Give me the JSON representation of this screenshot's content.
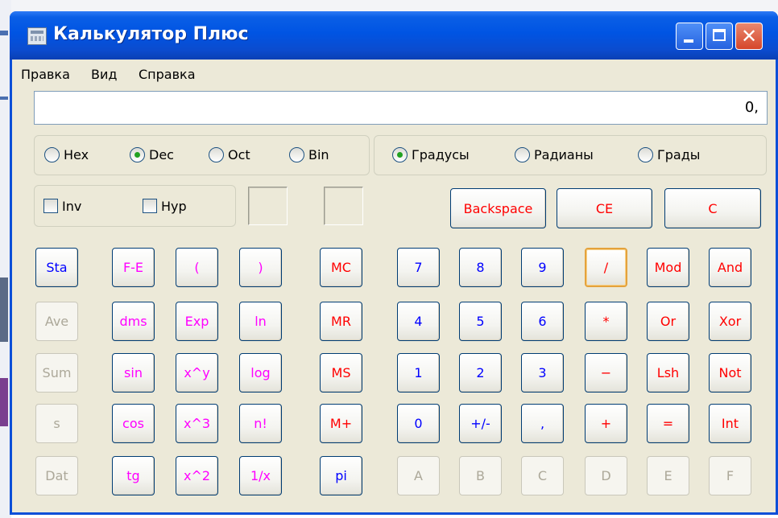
{
  "window": {
    "title": "Калькулятор Плюс"
  },
  "menu": [
    "Правка",
    "Вид",
    "Справка"
  ],
  "display": {
    "value": "0,"
  },
  "number_base": {
    "options": [
      "Hex",
      "Dec",
      "Oct",
      "Bin"
    ],
    "selected": "Dec"
  },
  "angle_unit": {
    "options": [
      "Градусы",
      "Радианы",
      "Грады"
    ],
    "selected": "Градусы"
  },
  "checkboxes": {
    "inv": "Inv",
    "hyp": "Hyp"
  },
  "edit_buttons": {
    "backspace": "Backspace",
    "ce": "CE",
    "c": "C"
  },
  "stat_buttons": [
    "Sta",
    "Ave",
    "Sum",
    "s",
    "Dat"
  ],
  "function_buttons": [
    [
      "F-E",
      "(",
      ")"
    ],
    [
      "dms",
      "Exp",
      "ln"
    ],
    [
      "sin",
      "x^y",
      "log"
    ],
    [
      "cos",
      "x^3",
      "n!"
    ],
    [
      "tg",
      "x^2",
      "1/x"
    ]
  ],
  "memory_buttons": [
    "MC",
    "MR",
    "MS",
    "M+",
    "pi"
  ],
  "keypad": [
    [
      "7",
      "8",
      "9",
      "/",
      "Mod",
      "And"
    ],
    [
      "4",
      "5",
      "6",
      "*",
      "Or",
      "Xor"
    ],
    [
      "1",
      "2",
      "3",
      "−",
      "Lsh",
      "Not"
    ],
    [
      "0",
      "+/-",
      ",",
      "+",
      "=",
      "Int"
    ],
    [
      "A",
      "B",
      "C",
      "D",
      "E",
      "F"
    ]
  ],
  "colors": {
    "titlebar": "#0054e3",
    "window_bg": "#ece9d8",
    "btn_text_blue": "#0000ff",
    "btn_text_red": "#ff0000",
    "btn_text_pink": "#ff00ff",
    "btn_text_disabled": "#aca899"
  }
}
